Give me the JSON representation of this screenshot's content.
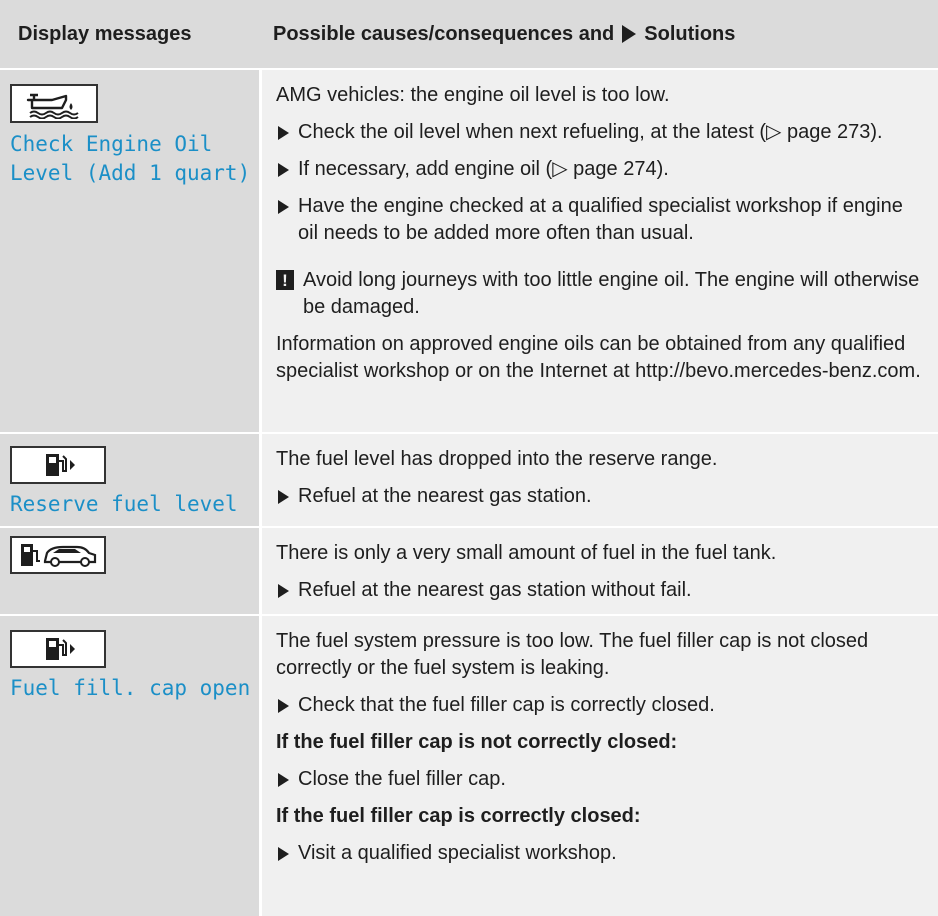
{
  "header": {
    "col1": "Display messages",
    "col2_pre": "Possible causes/consequences and",
    "col2_post": "Solutions"
  },
  "rows": [
    {
      "icon": "engine-oil-can-icon",
      "message": "Check Engine Oil Level (Add 1 quart)",
      "message_line1": "Check Engine Oil",
      "message_line2": "Level (Add 1 quart)",
      "intro": "AMG vehicles: the engine oil level is too low.",
      "bullets": [
        "Check the oil level when next refueling, at the latest (▷ page 273).",
        "If necessary, add engine oil (▷ page 274).",
        "Have the engine checked at a qualified specialist workshop if engine oil needs to be added more often than usual."
      ],
      "warning": "Avoid long journeys with too little engine oil. The engine will otherwise be damaged.",
      "info": "Information on approved engine oils can be obtained from any qualified specialist workshop or on the Internet at http://bevo.mercedes-benz.com."
    },
    {
      "icon": "fuel-pump-icon",
      "message": "Reserve fuel level",
      "intro": "The fuel level has dropped into the reserve range.",
      "bullets": [
        "Refuel at the nearest gas station."
      ]
    },
    {
      "icon": "fuel-pump-car-icon",
      "intro": "There is only a very small amount of fuel in the fuel tank.",
      "bullets": [
        "Refuel at the nearest gas station without fail."
      ]
    },
    {
      "icon": "fuel-pump-icon",
      "message": "Fuel fill. cap open",
      "intro": "The fuel system pressure is too low. The fuel filler cap is not closed correctly or the fuel system is leaking.",
      "bullet1": "Check that the fuel filler cap is correctly closed.",
      "heading1": "If the fuel filler cap is not correctly closed:",
      "bullet2": "Close the fuel filler cap.",
      "heading2": "If the fuel filler cap is correctly closed:",
      "bullet3": "Visit a qualified specialist workshop."
    }
  ]
}
